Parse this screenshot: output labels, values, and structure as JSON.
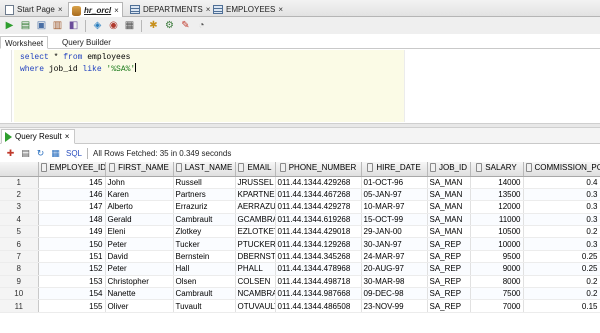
{
  "doc_tabs": [
    {
      "label": "Start Page",
      "icon": "start-page-icon",
      "active": false
    },
    {
      "label": "hr_orcl",
      "icon": "database-icon",
      "active": true
    },
    {
      "label": "DEPARTMENTS",
      "icon": "table-icon",
      "active": false
    },
    {
      "label": "EMPLOYEES",
      "icon": "table-icon",
      "active": false
    }
  ],
  "close_glyph": "×",
  "editor_toolbar": [
    "run-statement-icon",
    "run-script-icon",
    "commit-icon",
    "rollback-icon",
    "explain-plan-icon",
    "autotrace-icon",
    "sql-tuning-icon",
    "clear-icon",
    "history-icon",
    "unshared-worksheet-icon",
    "format-icon",
    "eraser-icon",
    "sql-history-icon"
  ],
  "worksheet_tabs": {
    "worksheet": "Worksheet",
    "query_builder": "Query Builder"
  },
  "sql": {
    "line1": {
      "kw1": "select",
      "mid": " * ",
      "kw2": "from",
      "rest": " employees"
    },
    "line2": {
      "kw1": "where",
      "mid": " job_id ",
      "kw2": "like",
      "str": " '%SA%'"
    }
  },
  "results": {
    "tab_label": "Query Result",
    "sql_link": "SQL",
    "fetch_message": "All Rows Fetched: 35 in 0.349 seconds",
    "toolbar_icons": [
      "pin-icon",
      "print-icon",
      "refresh-icon",
      "export-icon"
    ],
    "columns": [
      "EMPLOYEE_ID",
      "FIRST_NAME",
      "LAST_NAME",
      "EMAIL",
      "PHONE_NUMBER",
      "HIRE_DATE",
      "JOB_ID",
      "SALARY",
      "COMMISSION_PCT"
    ],
    "rows": [
      [
        "1",
        "145",
        "John",
        "Russell",
        "JRUSSEL",
        "011.44.1344.429268",
        "01-OCT-96",
        "SA_MAN",
        "14000",
        "0.4"
      ],
      [
        "2",
        "146",
        "Karen",
        "Partners",
        "KPARTNER",
        "011.44.1344.467268",
        "05-JAN-97",
        "SA_MAN",
        "13500",
        "0.3"
      ],
      [
        "3",
        "147",
        "Alberto",
        "Errazuriz",
        "AERRAZUR",
        "011.44.1344.429278",
        "10-MAR-97",
        "SA_MAN",
        "12000",
        "0.3"
      ],
      [
        "4",
        "148",
        "Gerald",
        "Cambrault",
        "GCAMBRAU",
        "011.44.1344.619268",
        "15-OCT-99",
        "SA_MAN",
        "11000",
        "0.3"
      ],
      [
        "5",
        "149",
        "Eleni",
        "Zlotkey",
        "EZLOTKEY",
        "011.44.1344.429018",
        "29-JAN-00",
        "SA_MAN",
        "10500",
        "0.2"
      ],
      [
        "6",
        "150",
        "Peter",
        "Tucker",
        "PTUCKER",
        "011.44.1344.129268",
        "30-JAN-97",
        "SA_REP",
        "10000",
        "0.3"
      ],
      [
        "7",
        "151",
        "David",
        "Bernstein",
        "DBERNSTE",
        "011.44.1344.345268",
        "24-MAR-97",
        "SA_REP",
        "9500",
        "0.25"
      ],
      [
        "8",
        "152",
        "Peter",
        "Hall",
        "PHALL",
        "011.44.1344.478968",
        "20-AUG-97",
        "SA_REP",
        "9000",
        "0.25"
      ],
      [
        "9",
        "153",
        "Christopher",
        "Olsen",
        "COLSEN",
        "011.44.1344.498718",
        "30-MAR-98",
        "SA_REP",
        "8000",
        "0.2"
      ],
      [
        "10",
        "154",
        "Nanette",
        "Cambrault",
        "NCAMBRAU",
        "011.44.1344.987668",
        "09-DEC-98",
        "SA_REP",
        "7500",
        "0.2"
      ],
      [
        "11",
        "155",
        "Oliver",
        "Tuvault",
        "OTUVAULT",
        "011.44.1344.486508",
        "23-NOV-99",
        "SA_REP",
        "7000",
        "0.15"
      ]
    ]
  }
}
